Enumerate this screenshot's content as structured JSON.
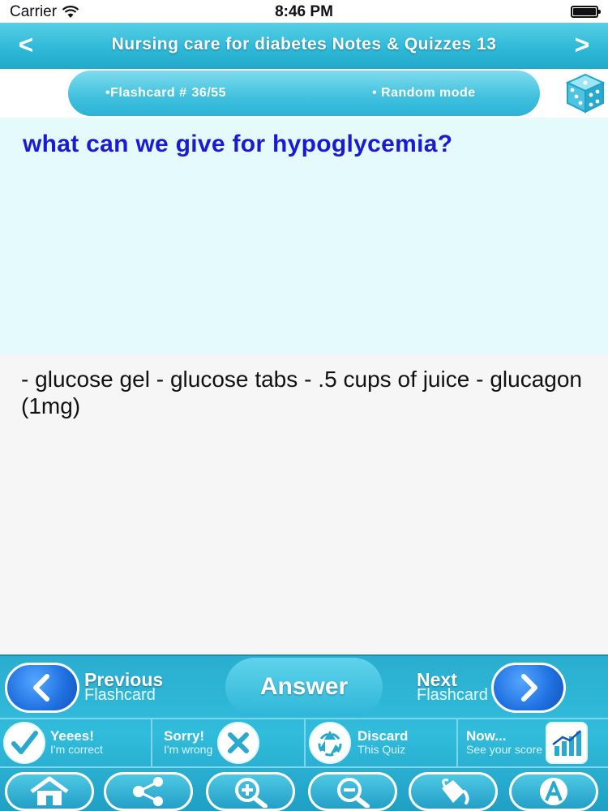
{
  "status_bar": {
    "carrier": "Carrier",
    "time": "8:46 PM"
  },
  "nav": {
    "title": "Nursing care for diabetes Notes & Quizzes 13",
    "back_symbol": "<",
    "forward_symbol": ">"
  },
  "info_bar": {
    "flashcard_label": "•Flashcard #",
    "flashcard_count": "36/55",
    "mode_label": "• Random mode"
  },
  "question": "what can we give for hypoglycemia?",
  "answer": "- glucose gel - glucose tabs - .5 cups of juice - glucagon (1mg)",
  "toolbar": {
    "previous": {
      "title": "Previous",
      "subtitle": "Flashcard"
    },
    "answer_label": "Answer",
    "next": {
      "title": "Next",
      "subtitle": "Flashcard"
    },
    "yes": {
      "title": "Yeees!",
      "subtitle": "I'm correct"
    },
    "sorry": {
      "title": "Sorry!",
      "subtitle": "I'm wrong"
    },
    "discard": {
      "title": "Discard",
      "subtitle": "This Quiz"
    },
    "score": {
      "title": "Now...",
      "subtitle": "See your score"
    }
  },
  "bottom_tools": [
    "home-icon",
    "share-icon",
    "zoom-in-icon",
    "zoom-out-icon",
    "paint-bucket-icon",
    "font-icon"
  ],
  "colors": {
    "accent": "#2fb9d8",
    "question_text": "#1a1ad6",
    "question_bg": "#e4fafc",
    "button_blue": "#1e6fe0"
  }
}
